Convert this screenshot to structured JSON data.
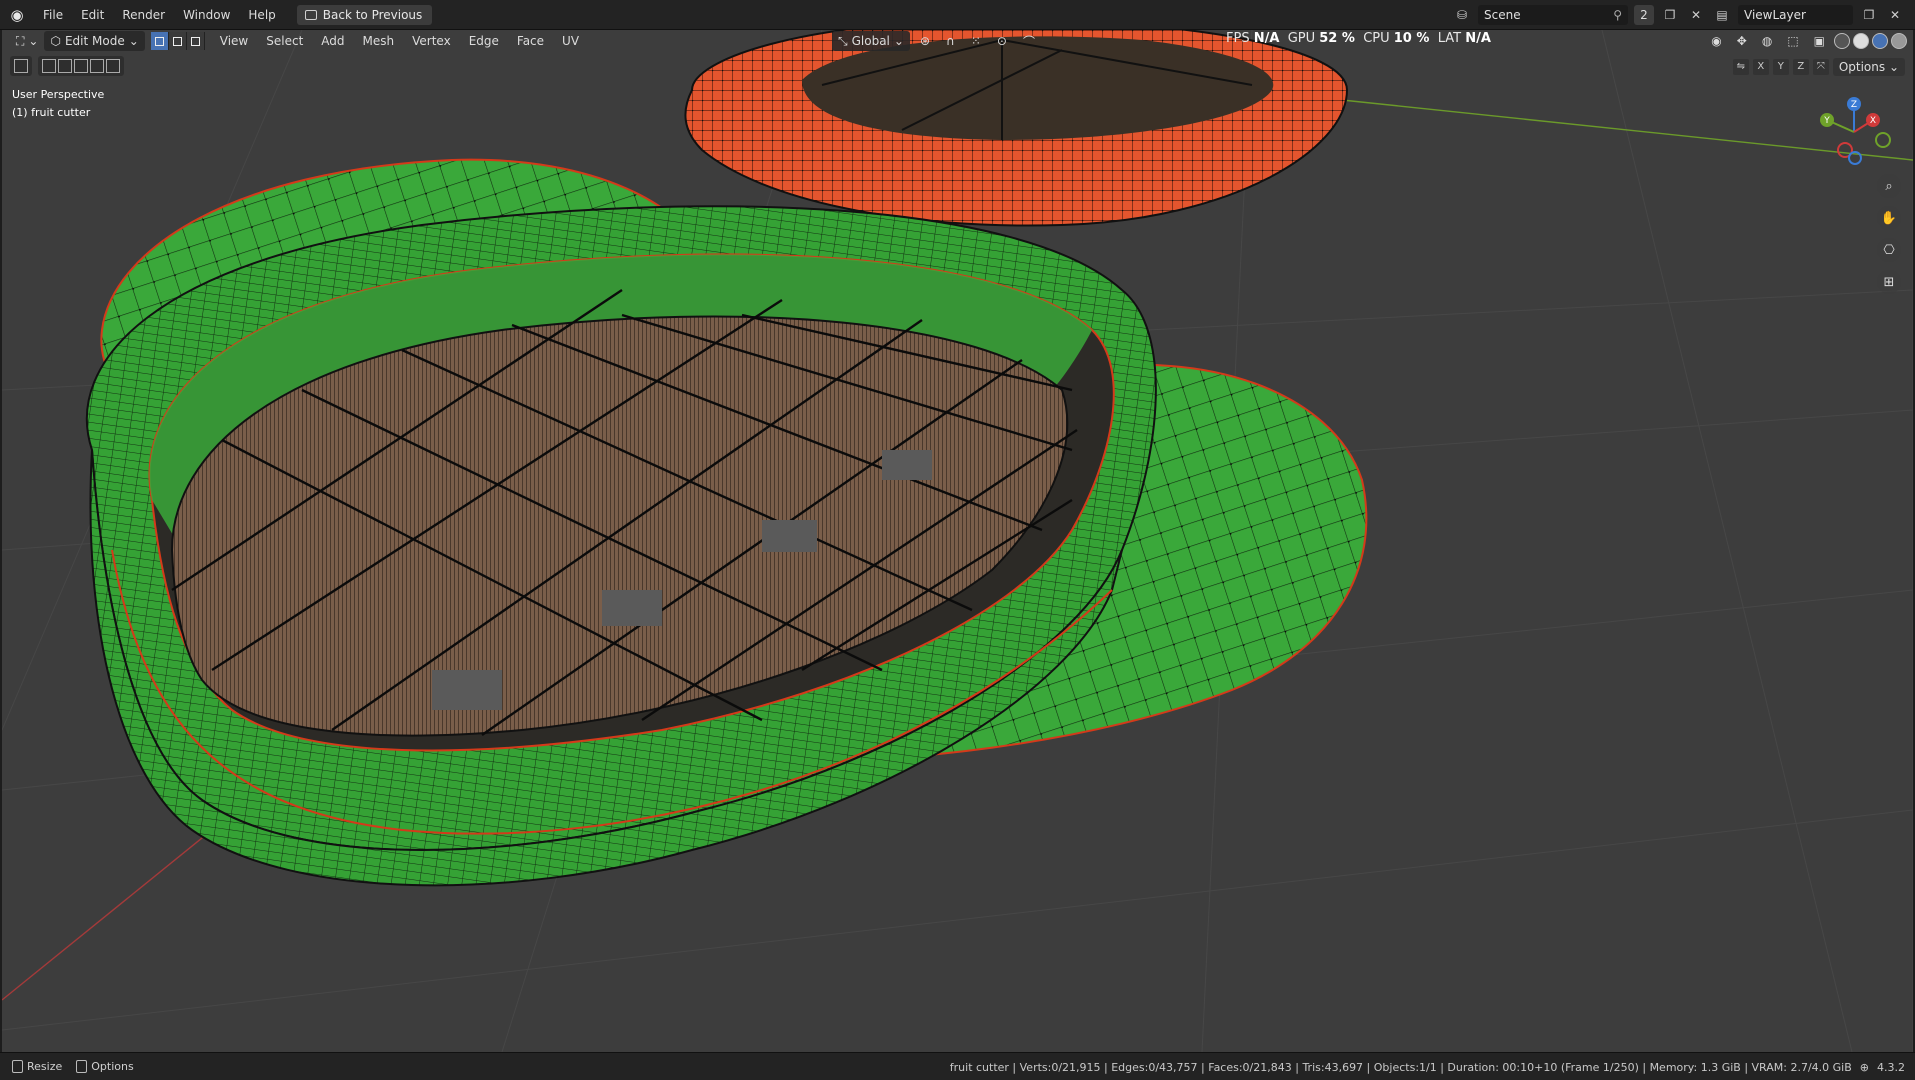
{
  "topbar": {
    "menus": [
      "File",
      "Edit",
      "Render",
      "Window",
      "Help"
    ],
    "back_label": "Back to Previous",
    "scene_name": "Scene",
    "scene_count": "2",
    "view_layer": "ViewLayer"
  },
  "header": {
    "mode": "Edit Mode",
    "menus": [
      "View",
      "Select",
      "Add",
      "Mesh",
      "Vertex",
      "Edge",
      "Face",
      "UV"
    ],
    "orientation": "Global",
    "options_label": "Options"
  },
  "stats": {
    "fps_label": "FPS",
    "fps_value": "N/A",
    "gpu_label": "GPU",
    "gpu_value": "52 %",
    "cpu_label": "CPU",
    "cpu_value": "10 %",
    "lat_label": "LAT",
    "lat_value": "N/A"
  },
  "axes": [
    "X",
    "Y",
    "Z"
  ],
  "viewport": {
    "perspective": "User Perspective",
    "object": "(1) fruit cutter"
  },
  "gizmo": {
    "x": "X",
    "y": "Y",
    "z": "Z"
  },
  "statusbar": {
    "resize": "Resize",
    "options": "Options",
    "info": "fruit cutter | Verts:0/21,915 | Edges:0/43,757 | Faces:0/21,843 | Tris:43,697 | Objects:1/1 | Duration: 00:10+10 (Frame 1/250) | Memory: 1.3 GiB | VRAM: 2.7/4.0 GiB",
    "version": "4.3.2"
  },
  "colors": {
    "green_mesh": "#3aa83a",
    "orange_mesh": "#e4552e",
    "viewport_bg": "#3d3d3d",
    "active_blue": "#4772b3"
  }
}
